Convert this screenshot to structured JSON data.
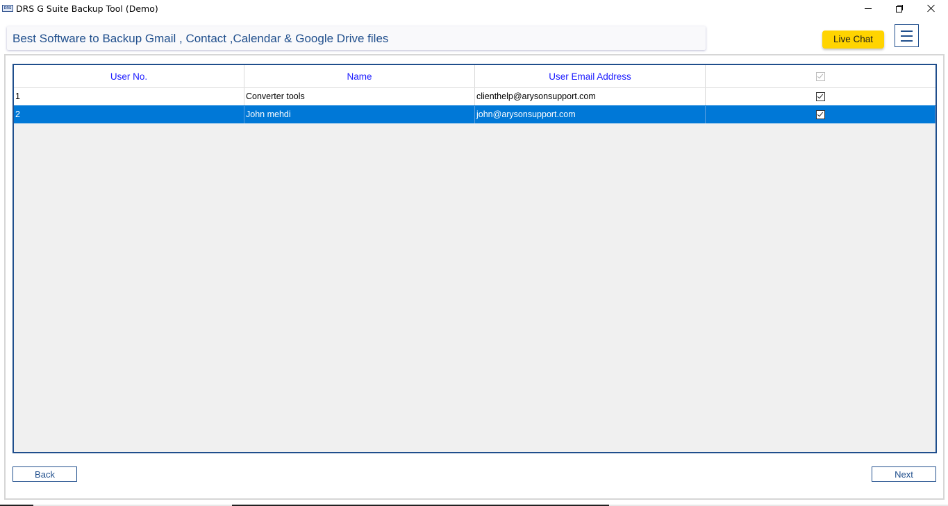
{
  "window": {
    "title": "DRS G Suite Backup Tool (Demo)",
    "icon_text": "DRS"
  },
  "banner": {
    "text": "Best Software to Backup Gmail , Contact ,Calendar & Google Drive files"
  },
  "header_actions": {
    "live_chat_label": "Live Chat",
    "menu_icon": "hamburger-menu-icon"
  },
  "table": {
    "columns": [
      "User No.",
      "Name",
      "User Email Address",
      ""
    ],
    "header_checkbox_checked": true,
    "rows": [
      {
        "user_no": "1",
        "name": "Converter tools",
        "email": "clienthelp@arysonsupport.com",
        "checked": true,
        "selected": false
      },
      {
        "user_no": "2",
        "name": "John mehdi",
        "email": "john@arysonsupport.com",
        "checked": true,
        "selected": true
      }
    ]
  },
  "footer": {
    "back_label": "Back",
    "next_label": "Next"
  },
  "colors": {
    "accent": "#1f4e8c",
    "header_text": "#1a1aff",
    "selection": "#0078d7",
    "live_chat_bg": "#ffd400"
  }
}
